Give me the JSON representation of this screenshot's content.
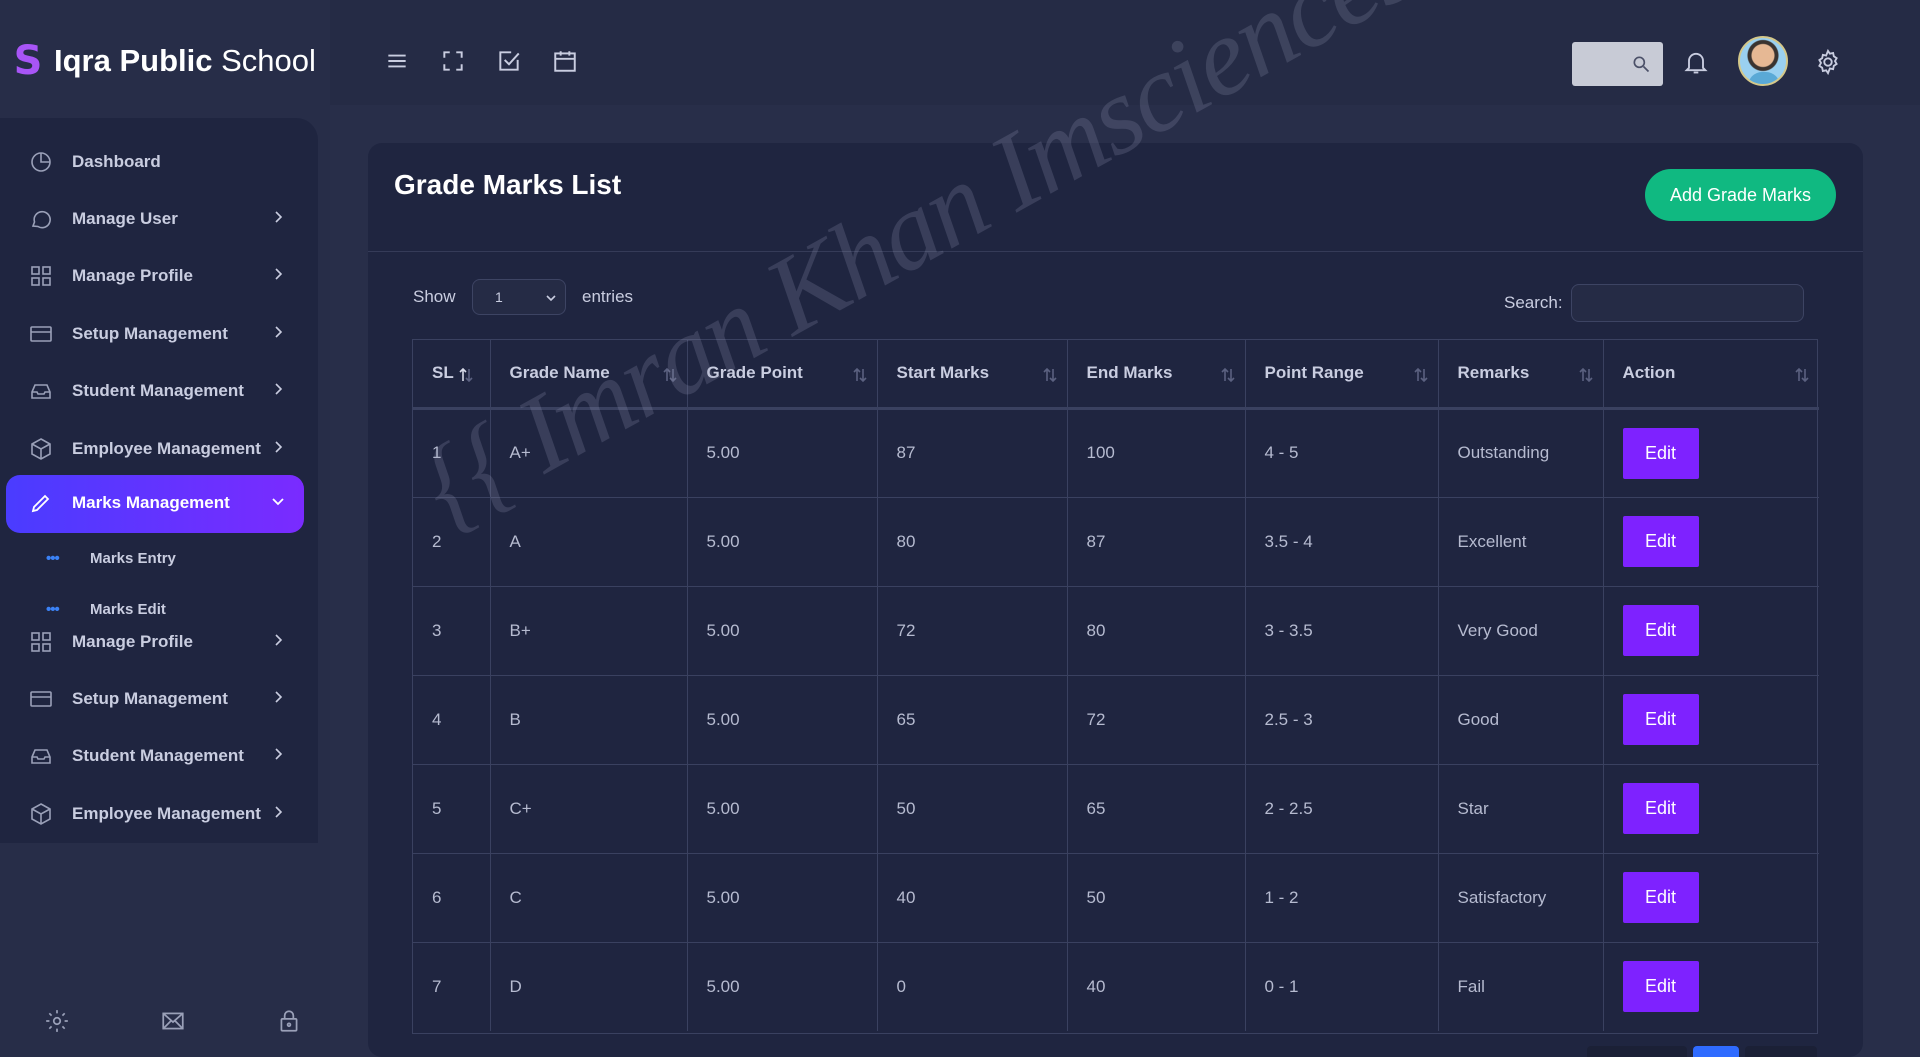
{
  "brand": {
    "bold": "Iqra Public",
    "rest": "School"
  },
  "sidebar": {
    "items": [
      {
        "label": "Dashboard",
        "icon": "pie-chart-icon"
      },
      {
        "label": "Manage User",
        "icon": "chat-icon"
      },
      {
        "label": "Manage Profile",
        "icon": "grid-icon"
      },
      {
        "label": "Setup Management",
        "icon": "card-icon"
      },
      {
        "label": "Student Management",
        "icon": "inbox-icon"
      },
      {
        "label": "Employee Management",
        "icon": "box-icon"
      },
      {
        "label": "Marks Management",
        "icon": "pencil-icon",
        "active": true
      },
      {
        "label": "Manage Profile",
        "icon": "grid-icon"
      },
      {
        "label": "Setup Management",
        "icon": "card-icon"
      },
      {
        "label": "Student Management",
        "icon": "inbox-icon"
      },
      {
        "label": "Employee Management",
        "icon": "box-icon"
      }
    ],
    "subitems": [
      {
        "label": "Marks Entry"
      },
      {
        "label": "Marks Edit"
      }
    ]
  },
  "page": {
    "title": "Grade Marks List",
    "add_button": "Add Grade Marks",
    "show_label": "Show",
    "entries_value": "1",
    "entries_label": "entries",
    "search_label": "Search:"
  },
  "table": {
    "headers": [
      "SL",
      "Grade Name",
      "Grade Point",
      "Start Marks",
      "End Marks",
      "Point Range",
      "Remarks",
      "Action"
    ],
    "rows": [
      [
        "1",
        "A+",
        "5.00",
        "87",
        "100",
        "4 - 5",
        "Outstanding"
      ],
      [
        "2",
        "A",
        "5.00",
        "80",
        "87",
        "3.5 - 4",
        "Excellent"
      ],
      [
        "3",
        "B+",
        "5.00",
        "72",
        "80",
        "3 - 3.5",
        "Very Good"
      ],
      [
        "4",
        "B",
        "5.00",
        "65",
        "72",
        "2.5 - 3",
        "Good"
      ],
      [
        "5",
        "C+",
        "5.00",
        "50",
        "65",
        "2 - 2.5",
        "Star"
      ],
      [
        "6",
        "C",
        "5.00",
        "40",
        "50",
        "1 - 2",
        "Satisfactory"
      ],
      [
        "7",
        "D",
        "5.00",
        "0",
        "40",
        "0 - 1",
        "Fail"
      ]
    ],
    "edit_label": "Edit"
  },
  "watermark": "{{ Imran Khan Imsciences }}",
  "colors": {
    "accent_purple": "#7e22ff",
    "active_gradient": "#5b2cff",
    "add_green": "#10b981",
    "background": "#282e49"
  }
}
